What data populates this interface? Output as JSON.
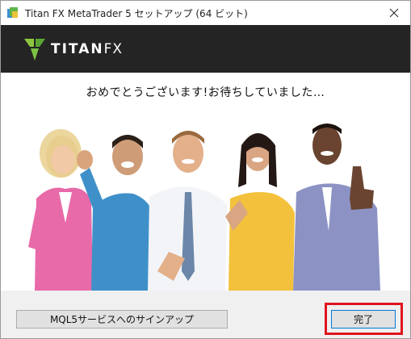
{
  "window": {
    "title": "Titan FX MetaTrader 5 セットアップ (64 ビット)",
    "close_icon": "close-icon"
  },
  "brand": {
    "logo_text_main": "TITAN",
    "logo_text_fx": "FX",
    "logo_mark_color": "#7dc242",
    "banner_color": "#242424"
  },
  "content": {
    "message": "おめでとうございます!お待ちしていました…"
  },
  "buttons": {
    "signup_label": "MQL5サービスへのサインアップ",
    "finish_label": "完了",
    "finish_highlight_color": "#e0141e"
  }
}
